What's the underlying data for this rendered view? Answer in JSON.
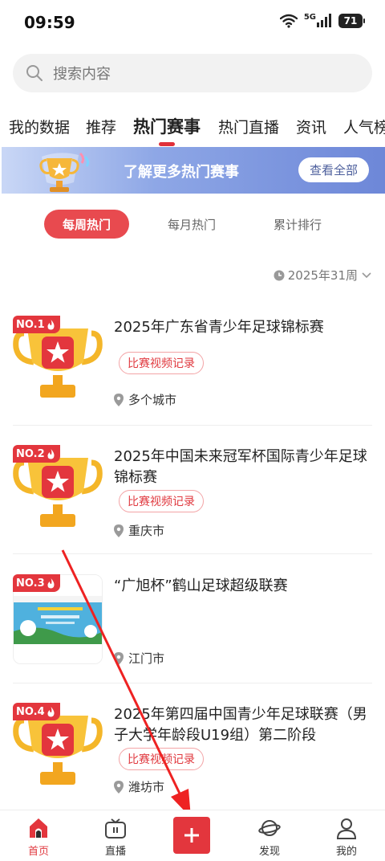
{
  "status_bar": {
    "time": "09:59",
    "network": "5G",
    "battery": "71"
  },
  "search": {
    "placeholder": "搜索内容"
  },
  "tabs": [
    {
      "label": "我的数据"
    },
    {
      "label": "推荐"
    },
    {
      "label": "热门赛事",
      "active": true
    },
    {
      "label": "热门直播"
    },
    {
      "label": "资讯"
    },
    {
      "label": "人气榜"
    }
  ],
  "banner": {
    "text": "了解更多热门赛事",
    "button": "查看全部"
  },
  "period_tabs": [
    {
      "label": "每周热门",
      "active": true
    },
    {
      "label": "每月热门"
    },
    {
      "label": "累计排行"
    }
  ],
  "week_selector": {
    "label": "2025年31周"
  },
  "events": [
    {
      "rank": "NO.1",
      "title": "2025年广东省青少年足球锦标赛",
      "tag": "比赛视频记录",
      "location": "多个城市",
      "thumb": "trophy"
    },
    {
      "rank": "NO.2",
      "title": "2025年中国未来冠军杯国际青少年足球锦标赛",
      "tag": "比赛视频记录",
      "location": "重庆市",
      "thumb": "trophy"
    },
    {
      "rank": "NO.3",
      "title": "“广旭杯”鹤山足球超级联赛",
      "tag": "",
      "location": "江门市",
      "thumb": "poster"
    },
    {
      "rank": "NO.4",
      "title": "2025年第四届中国青少年足球联赛（男子大学年龄段U19组）第二阶段",
      "tag": "比赛视频记录",
      "location": "潍坊市",
      "thumb": "trophy"
    }
  ],
  "bottom_nav": [
    {
      "label": "首页",
      "icon": "home-icon",
      "active": true
    },
    {
      "label": "直播",
      "icon": "tv-icon"
    },
    {
      "label": "",
      "icon": "plus-icon"
    },
    {
      "label": "发现",
      "icon": "planet-icon"
    },
    {
      "label": "我的",
      "icon": "user-icon"
    }
  ],
  "colors": {
    "accent": "#e3363d",
    "banner_from": "#c9d7f6",
    "banner_to": "#6d87d8"
  }
}
